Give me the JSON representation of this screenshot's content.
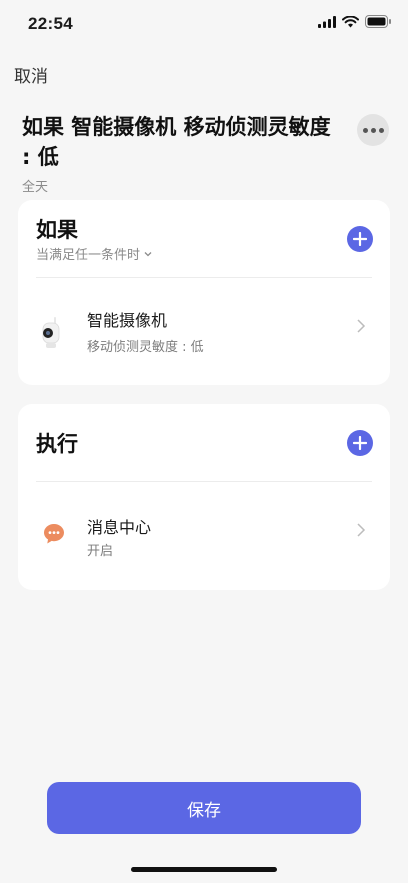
{
  "status_bar": {
    "time": "22:54"
  },
  "nav": {
    "cancel_label": "取消"
  },
  "header": {
    "title": "如果 智能摄像机 移动侦测灵敏度 : 低",
    "subtitle": "全天"
  },
  "condition_card": {
    "heading": "如果",
    "mode_label": "当满足任一条件时",
    "item": {
      "title": "智能摄像机",
      "subtitle": "移动侦测灵敏度 : 低"
    }
  },
  "action_card": {
    "heading": "执行",
    "item": {
      "title": "消息中心",
      "subtitle": "开启"
    }
  },
  "footer": {
    "save_label": "保存"
  },
  "colors": {
    "accent": "#5b67e4",
    "message_icon": "#ec8c5f"
  }
}
